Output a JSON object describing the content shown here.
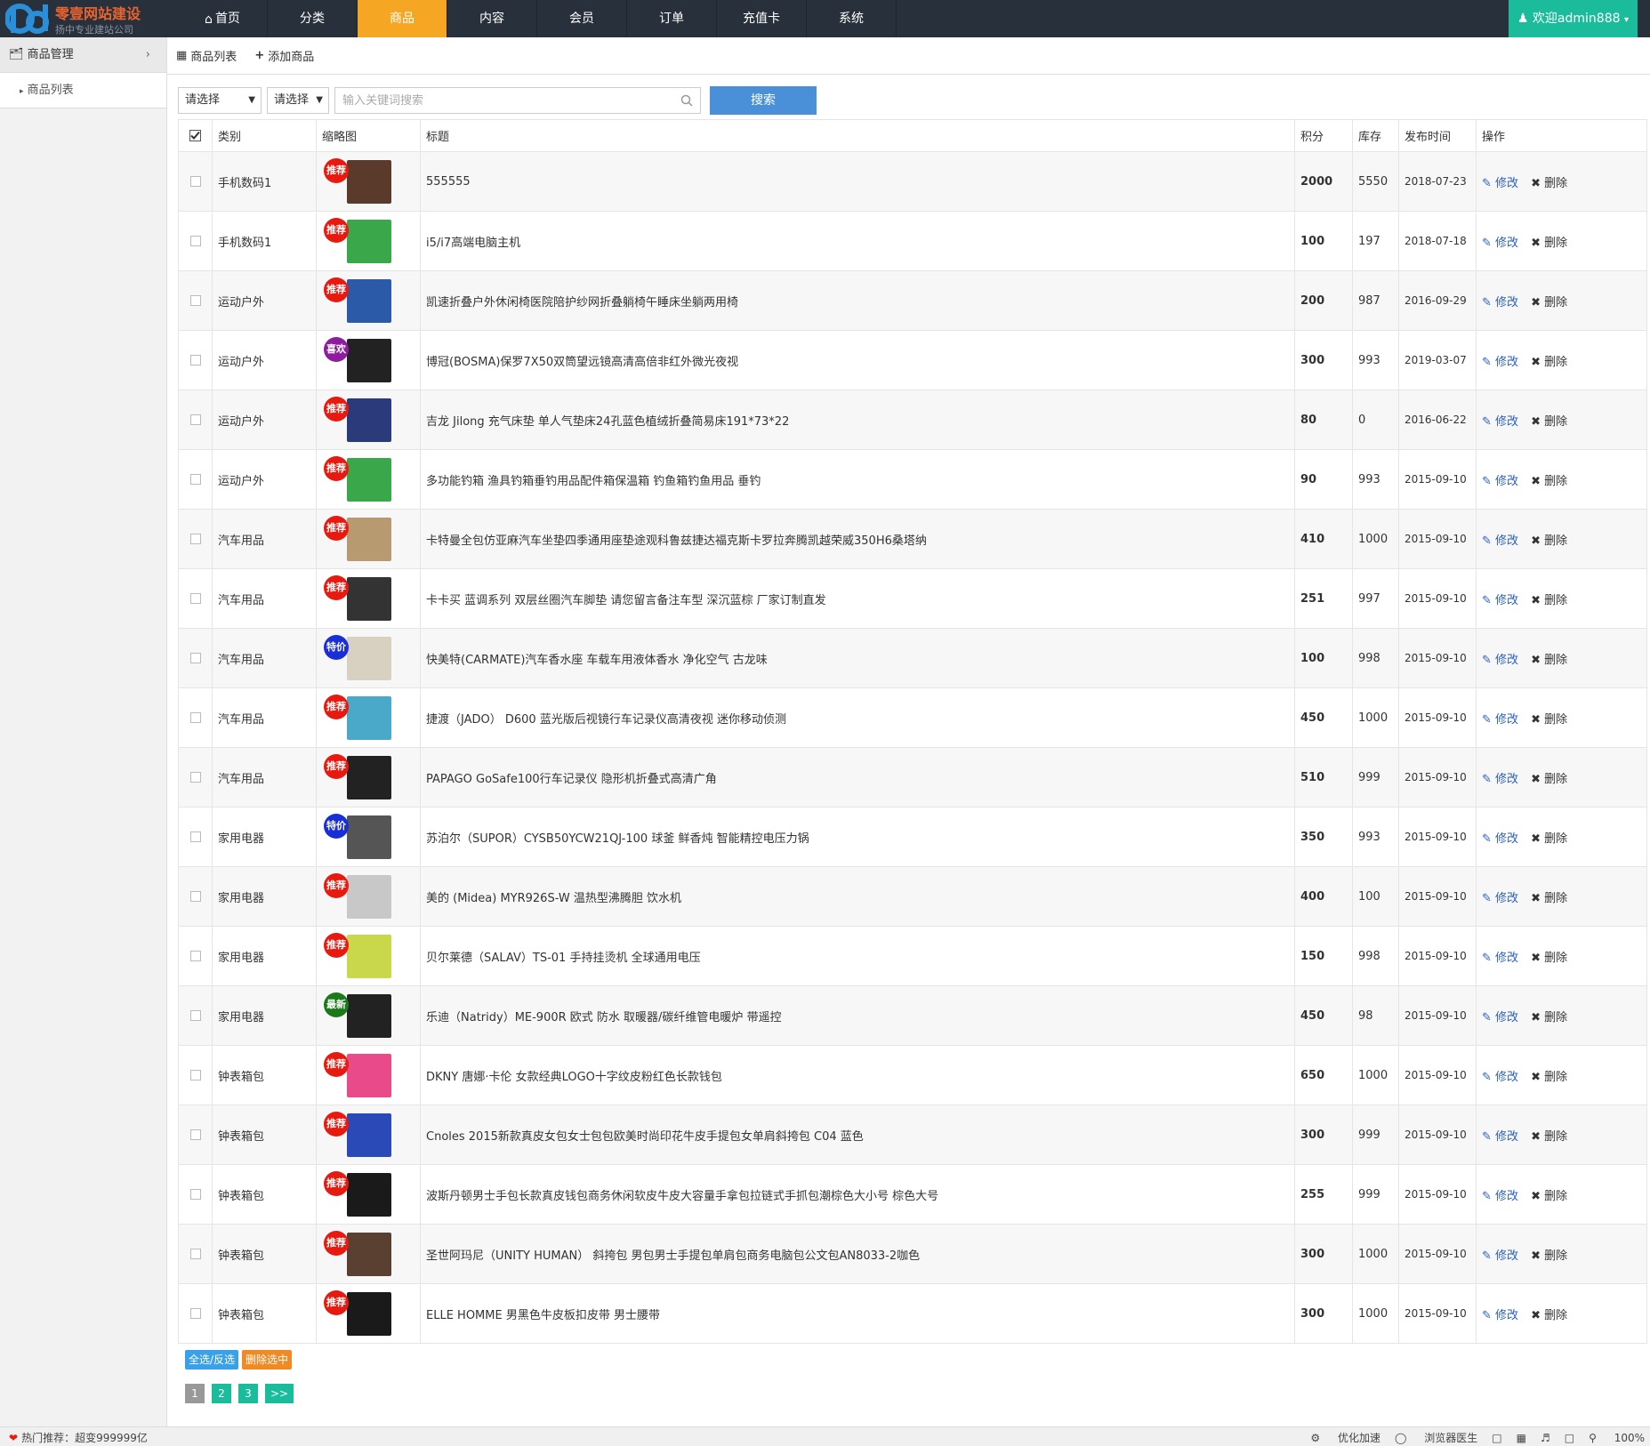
{
  "brand": {
    "title": "零壹网站建设",
    "subtitle": "扬中专业建站公司"
  },
  "nav": [
    {
      "label": "首页",
      "icon": "home-icon",
      "active": false
    },
    {
      "label": "分类",
      "active": false
    },
    {
      "label": "商品",
      "active": true
    },
    {
      "label": "内容",
      "active": false
    },
    {
      "label": "会员",
      "active": false
    },
    {
      "label": "订单",
      "active": false
    },
    {
      "label": "充值卡",
      "active": false
    },
    {
      "label": "系统",
      "active": false
    }
  ],
  "user": {
    "label": "欢迎admin888"
  },
  "sidebar": {
    "header": "商品管理",
    "items": [
      {
        "label": "商品列表"
      }
    ]
  },
  "tabs": [
    {
      "label": "商品列表",
      "icon": "grid-icon"
    },
    {
      "label": "添加商品",
      "icon": "plus-icon"
    }
  ],
  "toolbar": {
    "select1": "请选择",
    "select2": "请选择",
    "search_placeholder": "输入关键词搜索",
    "search_button": "搜索"
  },
  "table": {
    "headers": {
      "category": "类别",
      "thumb": "缩略图",
      "title": "标题",
      "points": "积分",
      "stock": "库存",
      "date": "发布时间",
      "ops": "操作"
    },
    "edit_label": "修改",
    "delete_label": "删除",
    "rows": [
      {
        "category": "手机数码1",
        "badge": "推荐",
        "badge_color": "#e8190e",
        "thumb_color": "#5a3a2a",
        "title": "555555",
        "points": "2000",
        "stock": "5550",
        "date": "2018-07-23"
      },
      {
        "category": "手机数码1",
        "badge": "推荐",
        "badge_color": "#e8190e",
        "thumb_color": "#3aa84a",
        "title": "i5/i7高端电脑主机",
        "points": "100",
        "stock": "197",
        "date": "2018-07-18"
      },
      {
        "category": "运动户外",
        "badge": "推荐",
        "badge_color": "#e8190e",
        "thumb_color": "#2a5aa8",
        "title": "凯速折叠户外休闲椅医院陪护纱网折叠躺椅午睡床坐躺两用椅",
        "points": "200",
        "stock": "987",
        "date": "2016-09-29"
      },
      {
        "category": "运动户外",
        "badge": "喜欢",
        "badge_color": "#8e1c9e",
        "thumb_color": "#222222",
        "title": "博冠(BOSMA)保罗7X50双筒望远镜高清高倍非红外微光夜视",
        "points": "300",
        "stock": "993",
        "date": "2019-03-07"
      },
      {
        "category": "运动户外",
        "badge": "推荐",
        "badge_color": "#e8190e",
        "thumb_color": "#2a3a7a",
        "title": "吉龙 Jilong 充气床垫 单人气垫床24孔蓝色植绒折叠简易床191*73*22",
        "points": "80",
        "stock": "0",
        "date": "2016-06-22"
      },
      {
        "category": "运动户外",
        "badge": "推荐",
        "badge_color": "#e8190e",
        "thumb_color": "#3aa84a",
        "title": "多功能钓箱 渔具钓箱垂钓用品配件箱保温箱 钓鱼箱钓鱼用品 垂钓",
        "points": "90",
        "stock": "993",
        "date": "2015-09-10"
      },
      {
        "category": "汽车用品",
        "badge": "推荐",
        "badge_color": "#e8190e",
        "thumb_color": "#b89a70",
        "title": "卡特曼全包仿亚麻汽车坐垫四季通用座垫途观科鲁兹捷达福克斯卡罗拉奔腾凯越荣威350H6桑塔纳",
        "points": "410",
        "stock": "1000",
        "date": "2015-09-10"
      },
      {
        "category": "汽车用品",
        "badge": "推荐",
        "badge_color": "#e8190e",
        "thumb_color": "#333333",
        "title": "卡卡买 蓝调系列 双层丝圈汽车脚垫 请您留言备注车型 深沉蓝棕 厂家订制直发",
        "points": "251",
        "stock": "997",
        "date": "2015-09-10"
      },
      {
        "category": "汽车用品",
        "badge": "特价",
        "badge_color": "#1a2ed8",
        "thumb_color": "#d8d0c0",
        "title": "快美特(CARMATE)汽车香水座 车载车用液体香水 净化空气 古龙味",
        "points": "100",
        "stock": "998",
        "date": "2015-09-10"
      },
      {
        "category": "汽车用品",
        "badge": "推荐",
        "badge_color": "#e8190e",
        "thumb_color": "#4aa8c8",
        "title": "捷渡（JADO） D600 蓝光版后视镜行车记录仪高清夜视 迷你移动侦测",
        "points": "450",
        "stock": "1000",
        "date": "2015-09-10"
      },
      {
        "category": "汽车用品",
        "badge": "推荐",
        "badge_color": "#e8190e",
        "thumb_color": "#222222",
        "title": "PAPAGO GoSafe100行车记录仪 隐形机折叠式高清广角",
        "points": "510",
        "stock": "999",
        "date": "2015-09-10"
      },
      {
        "category": "家用电器",
        "badge": "特价",
        "badge_color": "#1a2ed8",
        "thumb_color": "#555555",
        "title": "苏泊尔（SUPOR）CYSB50YCW21QJ-100 球釜 鲜香炖 智能精控电压力锅",
        "points": "350",
        "stock": "993",
        "date": "2015-09-10"
      },
      {
        "category": "家用电器",
        "badge": "推荐",
        "badge_color": "#e8190e",
        "thumb_color": "#c8c8c8",
        "title": "美的 (Midea) MYR926S-W 温热型沸腾胆 饮水机",
        "points": "400",
        "stock": "100",
        "date": "2015-09-10"
      },
      {
        "category": "家用电器",
        "badge": "推荐",
        "badge_color": "#e8190e",
        "thumb_color": "#c8d84a",
        "title": "贝尔莱德（SALAV）TS-01 手持挂烫机 全球通用电压",
        "points": "150",
        "stock": "998",
        "date": "2015-09-10"
      },
      {
        "category": "家用电器",
        "badge": "最新",
        "badge_color": "#1a7a1a",
        "thumb_color": "#222222",
        "title": "乐迪（Natridy）ME-900R 欧式 防水 取暖器/碳纤维管电暖炉 带遥控",
        "points": "450",
        "stock": "98",
        "date": "2015-09-10"
      },
      {
        "category": "钟表箱包",
        "badge": "推荐",
        "badge_color": "#e8190e",
        "thumb_color": "#e84a8a",
        "title": "DKNY 唐娜·卡伦 女款经典LOGO十字纹皮粉红色长款钱包",
        "points": "650",
        "stock": "1000",
        "date": "2015-09-10"
      },
      {
        "category": "钟表箱包",
        "badge": "推荐",
        "badge_color": "#e8190e",
        "thumb_color": "#2a4ab8",
        "title": "Cnoles 2015新款真皮女包女士包包欧美时尚印花牛皮手提包女单肩斜挎包 C04 蓝色",
        "points": "300",
        "stock": "999",
        "date": "2015-09-10"
      },
      {
        "category": "钟表箱包",
        "badge": "推荐",
        "badge_color": "#e8190e",
        "thumb_color": "#1a1a1a",
        "title": "波斯丹顿男士手包长款真皮钱包商务休闲软皮牛皮大容量手拿包拉链式手抓包潮棕色大小号 棕色大号",
        "points": "255",
        "stock": "999",
        "date": "2015-09-10"
      },
      {
        "category": "钟表箱包",
        "badge": "推荐",
        "badge_color": "#e8190e",
        "thumb_color": "#5a4030",
        "title": "圣世阿玛尼（UNITY HUMAN） 斜挎包 男包男士手提包单肩包商务电脑包公文包AN8033-2咖色",
        "points": "300",
        "stock": "1000",
        "date": "2015-09-10"
      },
      {
        "category": "钟表箱包",
        "badge": "推荐",
        "badge_color": "#e8190e",
        "thumb_color": "#1a1a1a",
        "title": "ELLE HOMME 男黑色牛皮板扣皮带 男士腰带",
        "points": "300",
        "stock": "1000",
        "date": "2015-09-10"
      }
    ]
  },
  "bulk": {
    "select_all": "全选/反选",
    "delete_selected": "删除选中"
  },
  "pager": [
    {
      "label": "1",
      "current": true
    },
    {
      "label": "2"
    },
    {
      "label": "3"
    },
    {
      "label": ">>"
    }
  ],
  "statusbar": {
    "left": "热门推荐：超变999999亿",
    "accelerate": "优化加速",
    "doctor": "浏览器医生",
    "zoom": "100%"
  },
  "colors": {
    "topbar": "#28313b",
    "active_nav": "#f5a623",
    "user": "#1abc9c",
    "search_btn": "#4a90d9",
    "select_all": "#3aa0e8",
    "delete_sel": "#f08a24",
    "pager_current": "#999999",
    "pager_other": "#1abc9c"
  }
}
